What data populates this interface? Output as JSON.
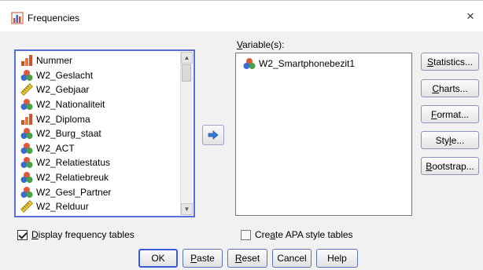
{
  "window": {
    "title": "Frequencies",
    "close_glyph": "×"
  },
  "source_list": {
    "items": [
      {
        "label": "Nummer",
        "type": "ordinal"
      },
      {
        "label": "W2_Geslacht",
        "type": "nominal"
      },
      {
        "label": "W2_Gebjaar",
        "type": "scale"
      },
      {
        "label": "W2_Nationaliteit",
        "type": "nominal"
      },
      {
        "label": "W2_Diploma",
        "type": "ordinal"
      },
      {
        "label": "W2_Burg_staat",
        "type": "nominal"
      },
      {
        "label": "W2_ACT",
        "type": "nominal"
      },
      {
        "label": "W2_Relatiestatus",
        "type": "nominal"
      },
      {
        "label": "W2_Relatiebreuk",
        "type": "nominal"
      },
      {
        "label": "W2_Gesl_Partner",
        "type": "nominal"
      },
      {
        "label": "W2_Relduur",
        "type": "scale"
      }
    ]
  },
  "target": {
    "label_ul": "V",
    "label_rest": "ariable(s):",
    "items": [
      {
        "label": "W2_Smartphonebezit1",
        "type": "nominal"
      }
    ]
  },
  "side_buttons": [
    {
      "ul": "S",
      "rest": "tatistics...",
      "pre": ""
    },
    {
      "ul": "C",
      "rest": "harts...",
      "pre": ""
    },
    {
      "ul": "F",
      "rest": "ormat...",
      "pre": ""
    },
    {
      "ul": "l",
      "rest": "e...",
      "pre": "Sty"
    },
    {
      "ul": "B",
      "rest": "ootstrap...",
      "pre": ""
    }
  ],
  "checkboxes": {
    "display_freq": {
      "ul": "D",
      "rest": "isplay frequency tables",
      "pre": "",
      "checked": true
    },
    "apa": {
      "pre": "Cre",
      "ul": "a",
      "rest": "te APA style tables",
      "checked": false
    }
  },
  "bottom_buttons": {
    "ok": "OK",
    "paste": {
      "ul": "P",
      "rest": "aste"
    },
    "reset": {
      "ul": "R",
      "rest": "eset"
    },
    "cancel": "Cancel",
    "help": "Help"
  },
  "colors": {
    "ordinal": "#d4522b",
    "nominal": "#3a6bd0",
    "scale": "#e6c73a",
    "accent": "#3b5bd0"
  }
}
